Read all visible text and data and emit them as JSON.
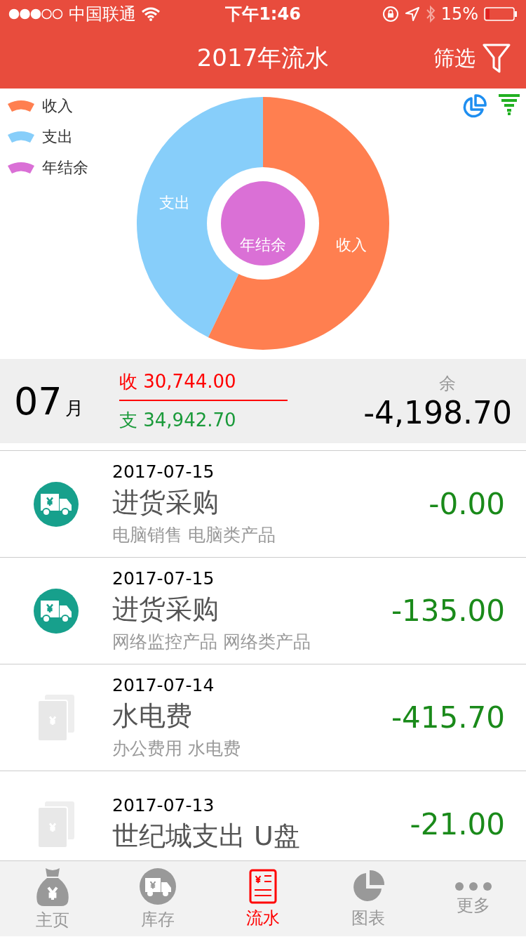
{
  "status_bar": {
    "carrier": "中国联通",
    "time": "下午1:46",
    "battery": "15%"
  },
  "nav_bar": {
    "title": "2017年流水",
    "action": "筛选"
  },
  "legend": [
    {
      "label": "收入",
      "color": "#ff7f50"
    },
    {
      "label": "支出",
      "color": "#87cefa"
    },
    {
      "label": "年结余",
      "color": "#da70d6"
    }
  ],
  "chart_labels": {
    "income": "收入",
    "expense": "支出",
    "balance": "年结余"
  },
  "summary": {
    "month": "07",
    "month_unit": "月",
    "income_label": "收",
    "income": "30,744.00",
    "expense_label": "支",
    "expense": "34,942.70",
    "balance_label": "余",
    "balance": "-4,198.70"
  },
  "transactions": [
    {
      "kind": "truck",
      "date": "2017-07-15",
      "title": "进货采购",
      "tags": "电脑销售 电脑类产品",
      "amount": "-0.00"
    },
    {
      "kind": "truck",
      "date": "2017-07-15",
      "title": "进货采购",
      "tags": "网络监控产品 网络类产品",
      "amount": "-135.00"
    },
    {
      "kind": "bill",
      "date": "2017-07-14",
      "title": "水电费",
      "tags": "办公费用 水电费",
      "amount": "-415.70"
    },
    {
      "kind": "bill",
      "date": "2017-07-13",
      "title": "世纪城支出 U盘",
      "amount": "-21.00"
    }
  ],
  "tab_bar": [
    {
      "kind": "bag",
      "label": "主页",
      "selected": false
    },
    {
      "kind": "truck",
      "label": "库存",
      "selected": false
    },
    {
      "kind": "ledger",
      "label": "流水",
      "selected": true
    },
    {
      "kind": "pie",
      "label": "图表",
      "selected": false
    },
    {
      "kind": "more",
      "label": "更多",
      "selected": false
    }
  ]
}
